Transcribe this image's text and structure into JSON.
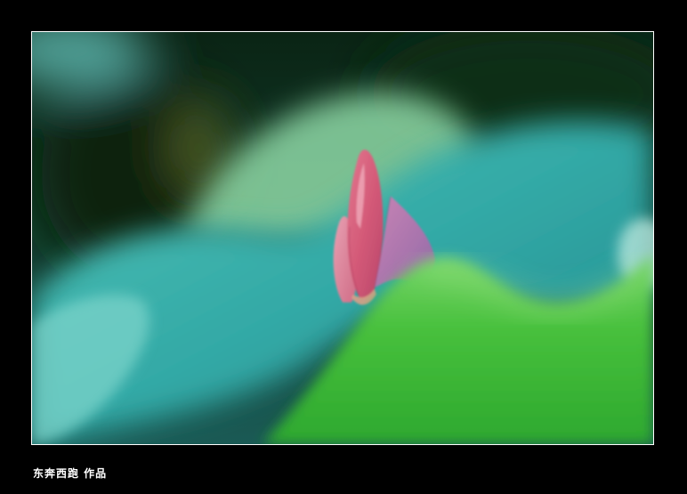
{
  "credit": {
    "text": "东奔西跑 作品"
  },
  "colors": {
    "background": "#000000",
    "border": "#ffffff",
    "bud_pink": "#d9607e",
    "leaf_teal": "#3fb3a8",
    "leaf_green": "#3fbf3a",
    "dark_green": "#0d2a14"
  }
}
